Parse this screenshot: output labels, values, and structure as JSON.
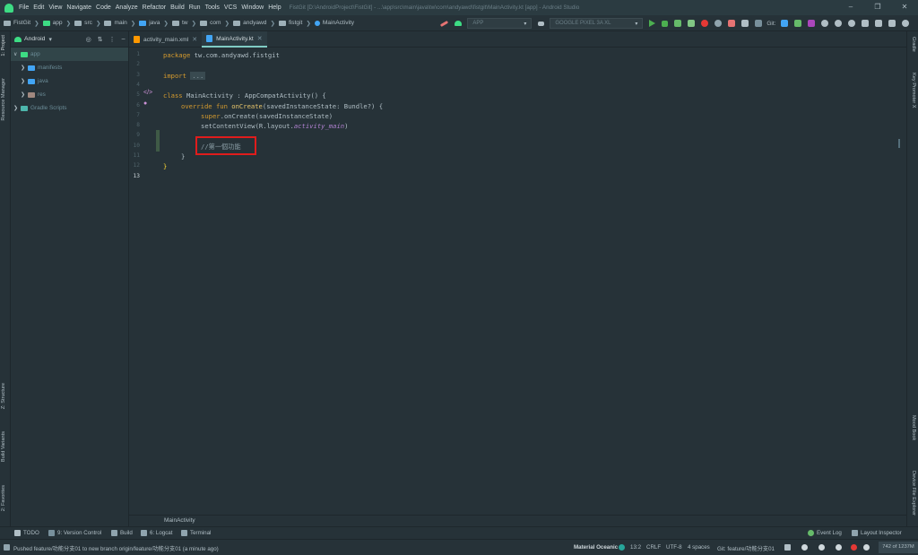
{
  "menubar": {
    "items": [
      "File",
      "Edit",
      "View",
      "Navigate",
      "Code",
      "Analyze",
      "Refactor",
      "Build",
      "Run",
      "Tools",
      "VCS",
      "Window",
      "Help"
    ],
    "title": "FistGit [D:\\AndroidProject\\FistGit] - ...\\app\\src\\main\\java\\tw\\com\\andyawd\\fistgit\\MainActivity.kt [app] - Android Studio"
  },
  "navbar": {
    "crumbs": [
      "FistGit",
      "app",
      "src",
      "main",
      "java",
      "tw",
      "com",
      "andyawd",
      "fistgit",
      "MainActivity"
    ],
    "run_config": "APP",
    "device": "GOOGLE PIXEL 3A XL",
    "git_label": "Git:"
  },
  "left_strip": {
    "project": "1: Project",
    "resource_manager": "Resource Manager",
    "structure": "Z: Structure",
    "build_variants": "Build Variants",
    "favorites": "2: Favorites"
  },
  "right_strip": {
    "gradle": "Gradle",
    "key_promoter": "Key Promoter X",
    "mood_book": "Mood Book",
    "device_file_explorer": "Device File Explorer"
  },
  "project_panel": {
    "view_mode": "Android",
    "tree": [
      {
        "label": "app",
        "level": 0,
        "expanded": true
      },
      {
        "label": "manifests",
        "level": 1
      },
      {
        "label": "java",
        "level": 1
      },
      {
        "label": "res",
        "level": 1
      },
      {
        "label": "Gradle Scripts",
        "level": 0
      }
    ]
  },
  "editor": {
    "tabs": [
      {
        "label": "activity_main.xml",
        "active": false
      },
      {
        "label": "MainActivity.kt",
        "active": true
      }
    ],
    "line_numbers": [
      "1",
      "2",
      "3",
      "4",
      "5",
      "6",
      "7",
      "8",
      "9",
      "10",
      "11",
      "12",
      "13"
    ],
    "code": {
      "l1_kw": "package",
      "l1_rest": " tw.com.andyawd.fistgit",
      "l3_kw": "import",
      "l3_fold": "...",
      "l6_kw": "class",
      "l6_rest": " MainActivity : AppCompatActivity() {",
      "l7_kw": "override fun",
      "l7_fn": " onCreate",
      "l7_rest": "(savedInstanceState: Bundle?) {",
      "l8_kw": "super",
      "l8_rest": ".onCreate(savedInstanceState)",
      "l9_rest": "setContentView(R.layout.",
      "l9_ital": "activity_main",
      "l9_end": ")",
      "l11_comment": "//第一個功能",
      "l12": "}",
      "l13": "}"
    },
    "breadcrumb": "MainActivity"
  },
  "tool_windows": {
    "todo": "TODO",
    "version_control": "9: Version Control",
    "build": "Build",
    "logcat": "6: Logcat",
    "terminal": "Terminal",
    "event_log": "Event Log",
    "layout_inspector": "Layout Inspector"
  },
  "statusbar": {
    "message": "Pushed feature/功能分支01 to new branch origin/feature/功能分支01 (a minute ago)",
    "theme": "Material Oceanic",
    "position": "13:2",
    "line_sep": "CRLF",
    "encoding": "UTF-8",
    "indent": "4 spaces",
    "branch": "Git: feature/功能分支01",
    "memory": "742 of 1237M"
  },
  "colors": {
    "accent": "#80cbc4",
    "highlight_box": "#e01c1c",
    "keyword": "#d49a2e",
    "android_green": "#3ddc84"
  }
}
